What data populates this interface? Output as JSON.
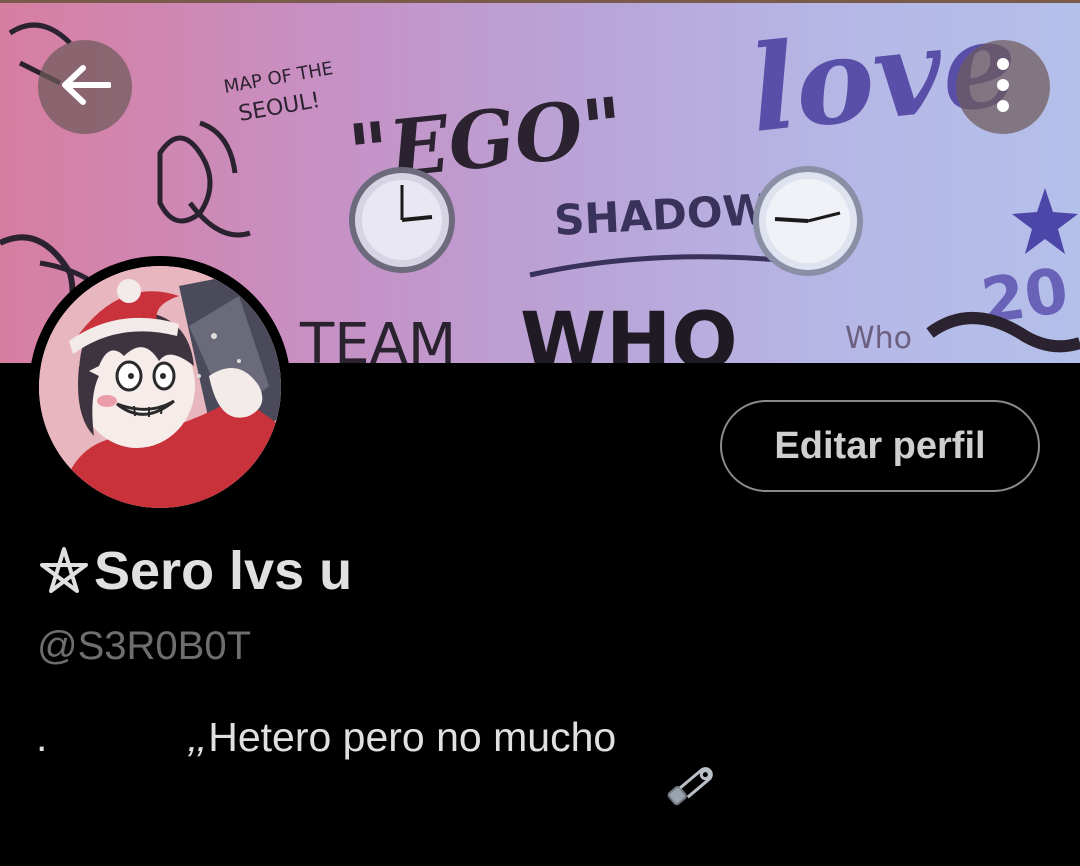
{
  "header": {
    "back_icon": "arrow-left-icon",
    "more_icon": "more-vertical-icon"
  },
  "banner": {
    "graffiti": {
      "map": "MAP OF THE",
      "seoul": "SEOUL!",
      "ego": "\"EGO\"",
      "shadow": "SHADOW",
      "love": "love",
      "team": "TEAM",
      "who_big": "WHO",
      "who_small": "Who",
      "num": "20"
    }
  },
  "profile": {
    "edit_button_label": "Editar perfil",
    "name_icon": "pentagram-icon",
    "display_name": "Sero lvs u",
    "handle": "@S3R0B0T",
    "bio_dot": ".",
    "bio_quote": "‚‚",
    "bio_text": "Hetero pero no mucho",
    "bio_icon": "safety-pin-icon"
  },
  "colors": {
    "background": "#000000",
    "text_primary": "#e0e0e0",
    "text_secondary": "#6e6e6e",
    "button_border": "#8a8a8a",
    "icon_button_bg": "#6e5a5a"
  }
}
